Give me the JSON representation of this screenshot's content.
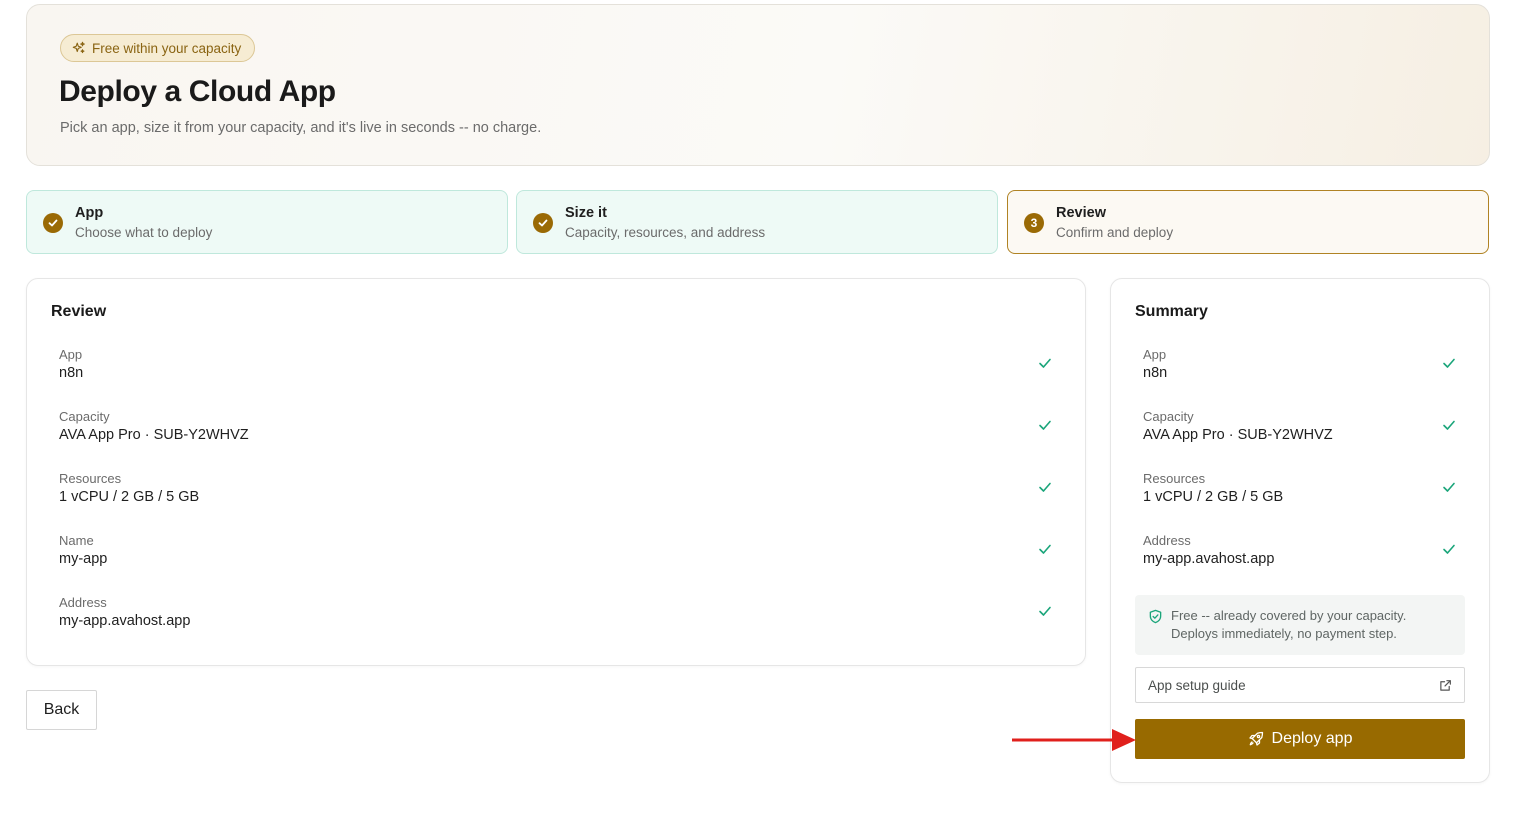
{
  "hero": {
    "badge": "Free within your capacity",
    "title": "Deploy a Cloud App",
    "subtitle": "Pick an app, size it from your capacity, and it's live in seconds -- no charge."
  },
  "steps": [
    {
      "title": "App",
      "subtitle": "Choose what to deploy",
      "state": "done"
    },
    {
      "title": "Size it",
      "subtitle": "Capacity, resources, and address",
      "state": "done"
    },
    {
      "title": "Review",
      "subtitle": "Confirm and deploy",
      "state": "active",
      "number": "3"
    }
  ],
  "review": {
    "title": "Review",
    "rows": [
      {
        "label": "App",
        "value": "n8n"
      },
      {
        "label": "Capacity",
        "value": "AVA App Pro · SUB-Y2WHVZ"
      },
      {
        "label": "Resources",
        "value": "1 vCPU / 2 GB / 5 GB"
      },
      {
        "label": "Name",
        "value": "my-app"
      },
      {
        "label": "Address",
        "value": "my-app.avahost.app"
      }
    ]
  },
  "summary": {
    "title": "Summary",
    "rows": [
      {
        "label": "App",
        "value": "n8n"
      },
      {
        "label": "Capacity",
        "value": "AVA App Pro · SUB-Y2WHVZ"
      },
      {
        "label": "Resources",
        "value": "1 vCPU / 2 GB / 5 GB"
      },
      {
        "label": "Address",
        "value": "my-app.avahost.app"
      }
    ],
    "note_line1": "Free -- already covered by your capacity.",
    "note_line2": "Deploys immediately, no payment step.",
    "guide_label": "App setup guide",
    "deploy_label": "Deploy app"
  },
  "back_label": "Back",
  "colors": {
    "accent": "#986a00",
    "check": "#1aa57a",
    "step_done_bg": "#eefaf6",
    "annotation_arrow": "#e0201c"
  }
}
